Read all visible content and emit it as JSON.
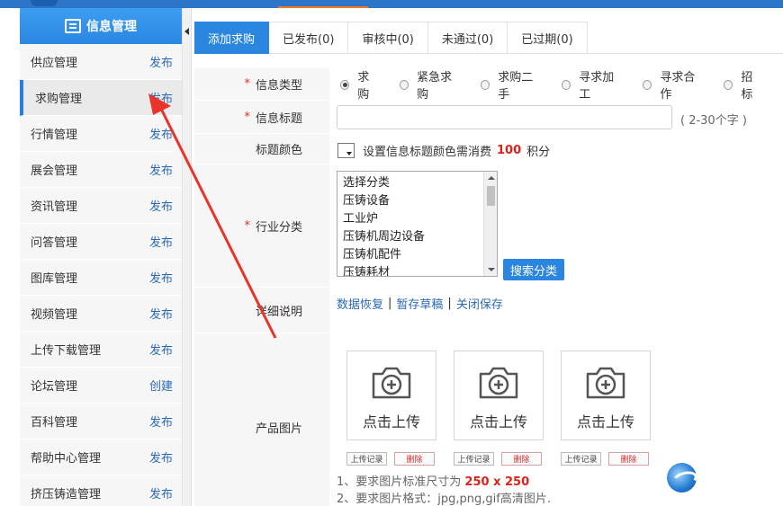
{
  "sidebar": {
    "header": "信息管理",
    "items": [
      {
        "label": "供应管理",
        "action": "发布"
      },
      {
        "label": "求购管理",
        "action": "发布"
      },
      {
        "label": "行情管理",
        "action": "发布"
      },
      {
        "label": "展会管理",
        "action": "发布"
      },
      {
        "label": "资讯管理",
        "action": "发布"
      },
      {
        "label": "问答管理",
        "action": "发布"
      },
      {
        "label": "图库管理",
        "action": "发布"
      },
      {
        "label": "视频管理",
        "action": "发布"
      },
      {
        "label": "上传下载管理",
        "action": "发布"
      },
      {
        "label": "论坛管理",
        "action": "创建"
      },
      {
        "label": "百科管理",
        "action": "发布"
      },
      {
        "label": "帮助中心管理",
        "action": "发布"
      },
      {
        "label": "挤压铸造管理",
        "action": "发布"
      }
    ],
    "active_index": 1
  },
  "tabs": [
    {
      "label": "添加求购"
    },
    {
      "label": "已发布(0)"
    },
    {
      "label": "审核中(0)"
    },
    {
      "label": "未通过(0)"
    },
    {
      "label": "已过期(0)"
    }
  ],
  "form": {
    "info_type": {
      "label": "信息类型",
      "options": [
        "求购",
        "紧急求购",
        "求购二手",
        "寻求加工",
        "寻求合作",
        "招标"
      ],
      "selected": "求购"
    },
    "title": {
      "label": "信息标题",
      "value": "",
      "hint": "( 2-30个字 )"
    },
    "title_color": {
      "label": "标题颜色",
      "text_before": "设置信息标题颜色需消费",
      "cost": "100",
      "text_after": "积分"
    },
    "category": {
      "label": "行业分类",
      "options": [
        "选择分类",
        "压铸设备",
        "工业炉",
        "压铸机周边设备",
        "压铸机配件",
        "压铸耗材"
      ],
      "search_button": "搜索分类"
    },
    "detail": {
      "label": "详细说明",
      "links": [
        "数据恢复",
        "暂存草稿",
        "关闭保存"
      ],
      "separator": "|"
    },
    "images": {
      "label": "产品图片",
      "upload_text": "点击上传",
      "record_label": "上传记录",
      "delete_label": "删除",
      "notes": {
        "line1_prefix": "1、要求图片标准尺寸为",
        "line1_size": "250 x 250",
        "line2": "2、要求图片格式：jpg,png,gif高清图片."
      }
    }
  },
  "colors": {
    "accent": "#2a86de",
    "required": "#e0301e",
    "link": "#2a6ab8",
    "annotation_arrow": "#e8342a"
  }
}
